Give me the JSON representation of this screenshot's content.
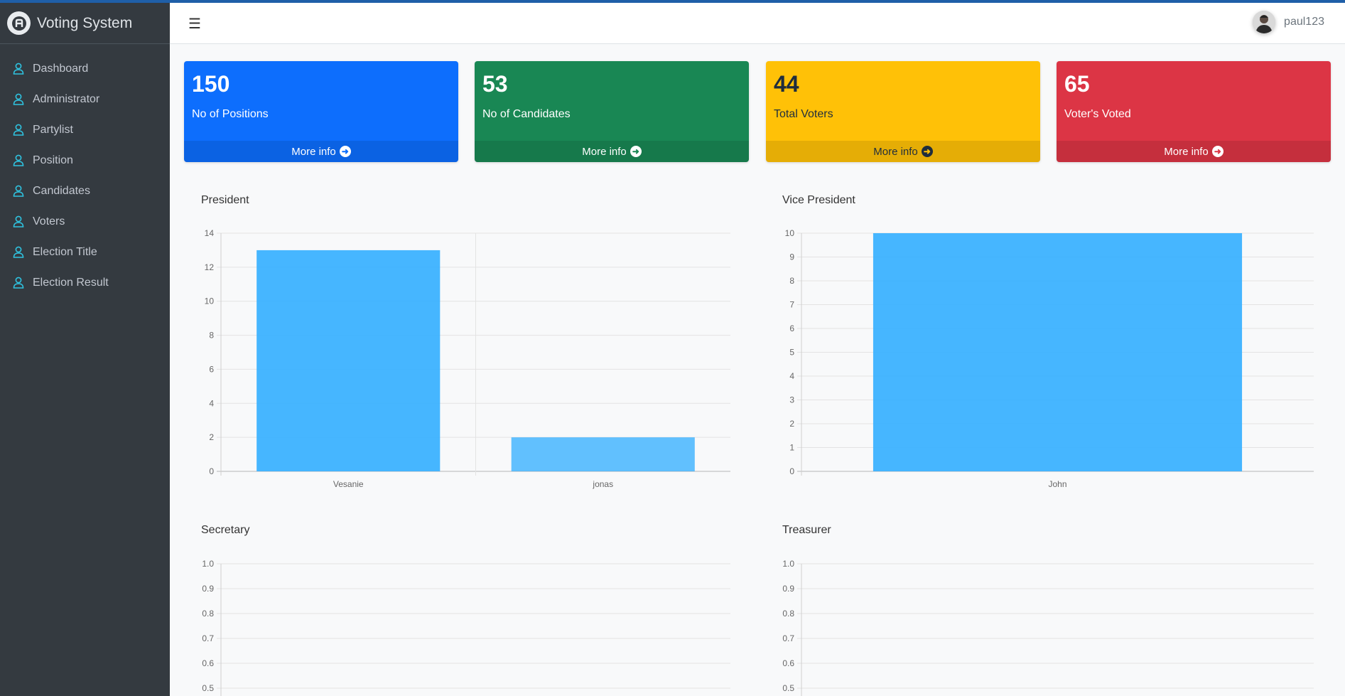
{
  "brand": {
    "name": "Voting System"
  },
  "sidebar": {
    "items": [
      {
        "label": "Dashboard"
      },
      {
        "label": "Administrator"
      },
      {
        "label": "Partylist"
      },
      {
        "label": "Position"
      },
      {
        "label": "Candidates"
      },
      {
        "label": "Voters"
      },
      {
        "label": "Election Title"
      },
      {
        "label": "Election Result"
      }
    ],
    "icon": "user-icon"
  },
  "navbar": {
    "menu_icon": "hamburger-icon",
    "username": "paul123"
  },
  "stats": [
    {
      "value": "150",
      "label": "No of Positions",
      "more": "More info",
      "color": "#0d6efd",
      "text_color": "#ffffff"
    },
    {
      "value": "53",
      "label": "No of Candidates",
      "more": "More info",
      "color": "#198754",
      "text_color": "#ffffff"
    },
    {
      "value": "44",
      "label": "Total Voters",
      "more": "More info",
      "color": "#ffc107",
      "text_color": "#1f2d3d"
    },
    {
      "value": "65",
      "label": "Voter's Voted",
      "more": "More info",
      "color": "#dc3545",
      "text_color": "#ffffff"
    }
  ],
  "chart_data": [
    {
      "type": "bar",
      "title": "President",
      "categories": [
        "Vesanie",
        "jonas"
      ],
      "values": [
        13,
        2
      ],
      "ylim": [
        0,
        14
      ],
      "yticks": [
        "0",
        "2",
        "4",
        "6",
        "8",
        "10",
        "12",
        "14"
      ],
      "grid": true,
      "color": "#36b0ff"
    },
    {
      "type": "bar",
      "title": "Vice President",
      "categories": [
        "John"
      ],
      "values": [
        10
      ],
      "ylim": [
        0,
        10
      ],
      "yticks": [
        "0",
        "1",
        "2",
        "3",
        "4",
        "5",
        "6",
        "7",
        "8",
        "9",
        "10"
      ],
      "grid": true,
      "color": "#36b0ff"
    },
    {
      "type": "bar",
      "title": "Secretary",
      "categories": [],
      "values": [],
      "ylim": [
        0,
        1
      ],
      "yticks": [
        "0.5",
        "0.6",
        "0.7",
        "0.8",
        "0.9",
        "1.0"
      ],
      "grid": true,
      "color": "#36b0ff"
    },
    {
      "type": "bar",
      "title": "Treasurer",
      "categories": [],
      "values": [],
      "ylim": [
        0,
        1
      ],
      "yticks": [
        "0.5",
        "0.6",
        "0.7",
        "0.8",
        "0.9",
        "1.0"
      ],
      "grid": true,
      "color": "#36b0ff"
    }
  ]
}
